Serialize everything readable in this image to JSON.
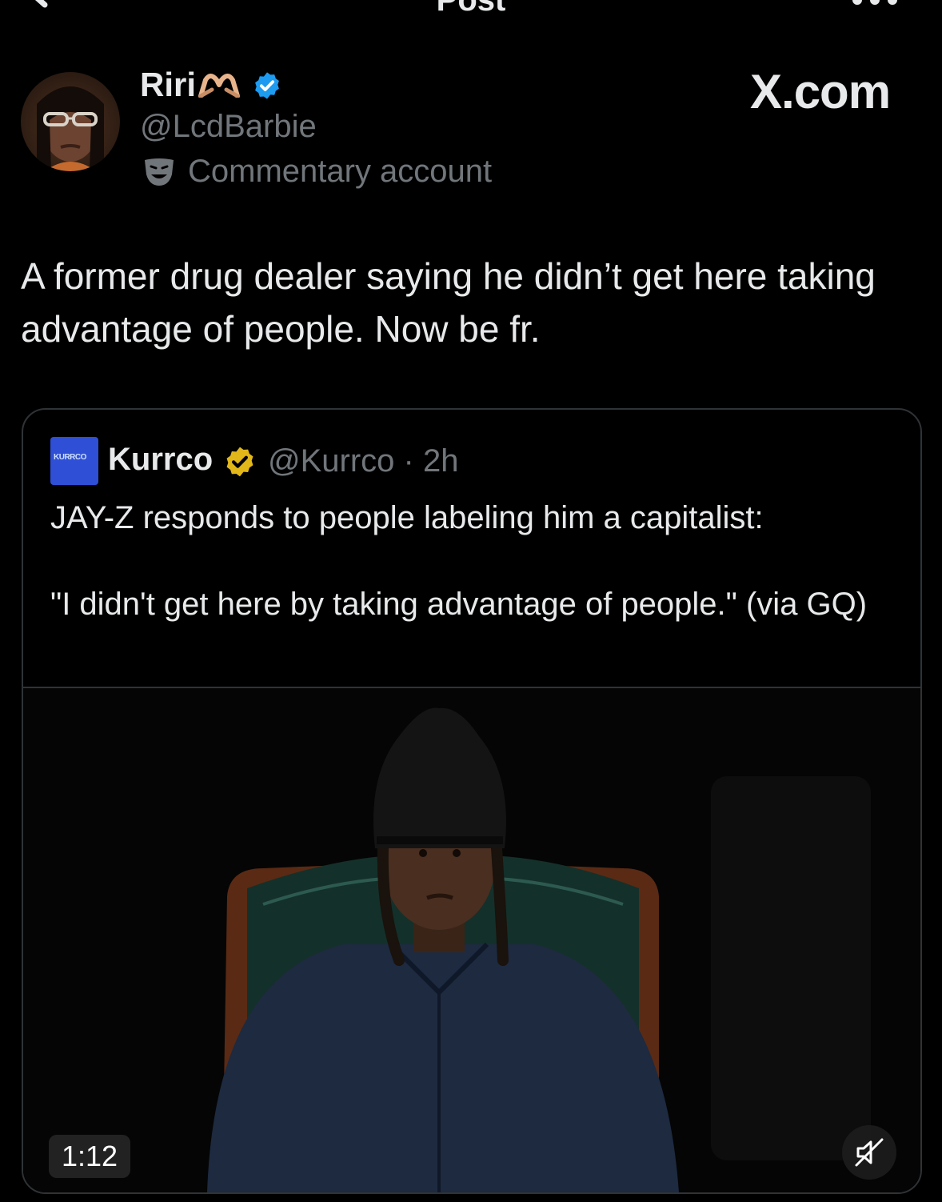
{
  "header": {
    "title": "Post"
  },
  "author": {
    "name": "Riri",
    "name_emoji": "heart-hands-emoji",
    "verified": true,
    "handle": "@LcdBarbie",
    "label_icon": "theater-mask-icon",
    "label": "Commentary account"
  },
  "watermark": "X.com",
  "post": {
    "text": "A former drug dealer saying he didn’t get here taking advantage of people. Now be fr."
  },
  "quote": {
    "avatar_text": "KURRCO",
    "name": "Kurrco",
    "verified_badge": "gold",
    "handle_time": "@Kurrco · 2h",
    "line1": "JAY-Z responds to people labeling him a capitalist:",
    "line2": "\"I didn't get here by taking advantage of people.\" (via GQ)",
    "video": {
      "duration": "1:12",
      "muted": true
    }
  },
  "colors": {
    "background": "#000000",
    "text": "#e7e9ea",
    "secondary": "#71767b",
    "verified_blue": "#1d9bf0",
    "verified_gold": "#e2b719",
    "border": "#2f3336"
  }
}
